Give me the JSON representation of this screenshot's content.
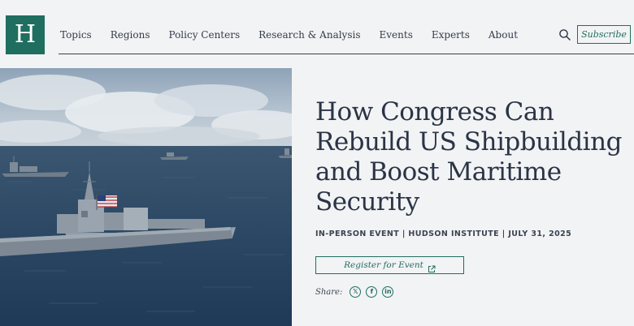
{
  "brand": {
    "logo_letter": "H",
    "brand_color": "#1f6e5f"
  },
  "nav": {
    "items": [
      {
        "label": "Topics"
      },
      {
        "label": "Regions"
      },
      {
        "label": "Policy Centers"
      },
      {
        "label": "Research & Analysis"
      },
      {
        "label": "Events"
      },
      {
        "label": "Experts"
      },
      {
        "label": "About"
      }
    ],
    "search_icon": "search-icon",
    "subscribe_label": "Subscribe"
  },
  "hero": {
    "image": "navy-destroyer-at-sea-photo",
    "title": "How Congress Can Rebuild US Shipbuilding and Boost Maritime Security",
    "meta": "IN-PERSON EVENT | HUDSON INSTITUTE | JULY 31, 2025",
    "register_label": "Register for Event",
    "register_icon": "external-link-icon",
    "share_label": "Share:",
    "share_icons": [
      "x-icon",
      "facebook-icon",
      "linkedin-icon"
    ]
  }
}
